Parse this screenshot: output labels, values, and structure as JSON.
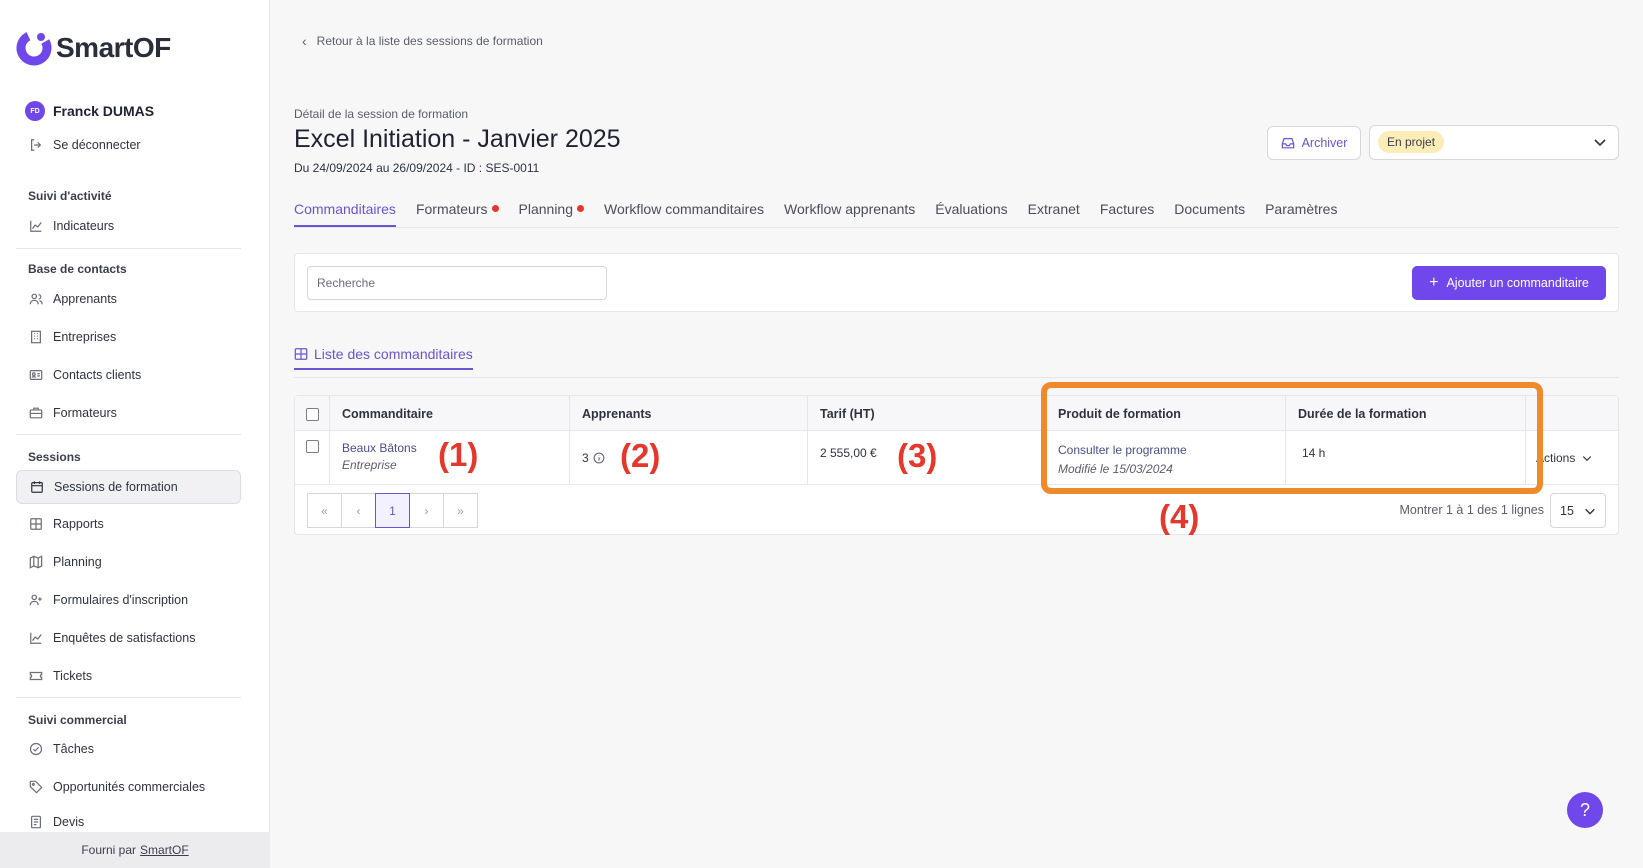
{
  "brand": {
    "name": "SmartOF",
    "accent": "#7047eb"
  },
  "user": {
    "initials": "FD",
    "name": "Franck DUMAS",
    "logout": "Se déconnecter"
  },
  "sidebar": {
    "sections": [
      {
        "title": "Suivi d'activité",
        "items": [
          {
            "label": "Indicateurs",
            "icon": "chart-icon"
          }
        ]
      },
      {
        "title": "Base de contacts",
        "items": [
          {
            "label": "Apprenants",
            "icon": "users-icon"
          },
          {
            "label": "Entreprises",
            "icon": "building-icon"
          },
          {
            "label": "Contacts clients",
            "icon": "contact-card-icon"
          },
          {
            "label": "Formateurs",
            "icon": "briefcase-icon"
          }
        ]
      },
      {
        "title": "Sessions",
        "items": [
          {
            "label": "Sessions de formation",
            "icon": "calendar-icon",
            "active": true
          },
          {
            "label": "Rapports",
            "icon": "table-icon"
          },
          {
            "label": "Planning",
            "icon": "map-icon"
          },
          {
            "label": "Formulaires d'inscription",
            "icon": "user-plus-icon"
          },
          {
            "label": "Enquêtes de satisfactions",
            "icon": "chart-icon"
          },
          {
            "label": "Tickets",
            "icon": "ticket-icon"
          }
        ]
      },
      {
        "title": "Suivi commercial",
        "items": [
          {
            "label": "Tâches",
            "icon": "check-circle-icon"
          },
          {
            "label": "Opportunités commerciales",
            "icon": "tag-icon"
          },
          {
            "label": "Devis",
            "icon": "document-icon"
          }
        ]
      }
    ],
    "footer": {
      "prefix": "Fourni par",
      "link": "SmartOF"
    }
  },
  "header": {
    "back": "Retour à la liste des sessions de formation",
    "sub_label": "Détail de la session de formation",
    "title": "Excel Initiation - Janvier 2025",
    "dates": "Du 24/09/2024 au 26/09/2024 - ID : SES-0011",
    "archive": "Archiver",
    "status": "En projet"
  },
  "tabs": [
    {
      "label": "Commanditaires",
      "active": true
    },
    {
      "label": "Formateurs",
      "dot": true
    },
    {
      "label": "Planning",
      "dot": true
    },
    {
      "label": "Workflow commanditaires"
    },
    {
      "label": "Workflow apprenants"
    },
    {
      "label": "Évaluations"
    },
    {
      "label": "Extranet"
    },
    {
      "label": "Factures"
    },
    {
      "label": "Documents"
    },
    {
      "label": "Paramètres"
    }
  ],
  "search": {
    "placeholder": "Recherche"
  },
  "add_button": "Ajouter un commanditaire",
  "list_tab": "Liste des commanditaires",
  "table": {
    "columns": [
      "Commanditaire",
      "Apprenants",
      "Tarif (HT)",
      "Produit de formation",
      "Durée de la formation"
    ],
    "row": {
      "commanditaire": "Beaux Bâtons",
      "type": "Entreprise",
      "apprenants": "3",
      "tarif": "2 555,00 €",
      "produit": "Consulter le programme",
      "modifie": "Modifié le 15/03/2024",
      "duree": "14 h",
      "actions": "Actions"
    }
  },
  "annotations": [
    "(1)",
    "(2)",
    "(3)",
    "(4)"
  ],
  "pagination": {
    "current": "1",
    "summary": "Montrer 1 à 1 des 1 lignes",
    "per_page": "15"
  },
  "help": "?"
}
